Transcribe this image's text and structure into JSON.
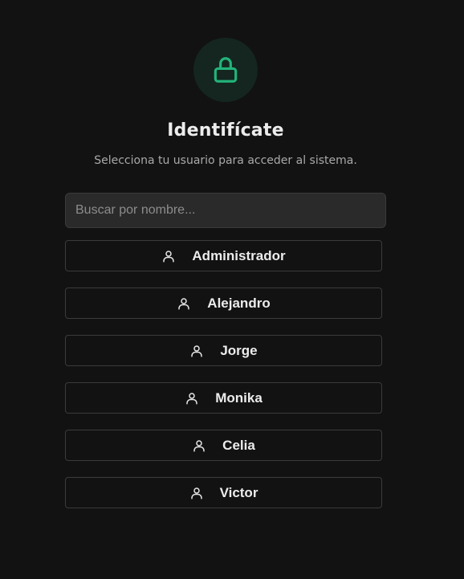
{
  "header": {
    "icon": "lock-icon",
    "accent_color": "#22b37a",
    "title": "Identifícate",
    "subtitle": "Selecciona tu usuario para acceder al sistema."
  },
  "search": {
    "value": "",
    "placeholder": "Buscar por nombre..."
  },
  "users": [
    {
      "name": "Administrador",
      "icon": "user-icon"
    },
    {
      "name": "Alejandro",
      "icon": "user-icon"
    },
    {
      "name": "Jorge",
      "icon": "user-icon"
    },
    {
      "name": "Monika",
      "icon": "user-icon"
    },
    {
      "name": "Celia",
      "icon": "user-icon"
    },
    {
      "name": "Victor",
      "icon": "user-icon"
    }
  ]
}
